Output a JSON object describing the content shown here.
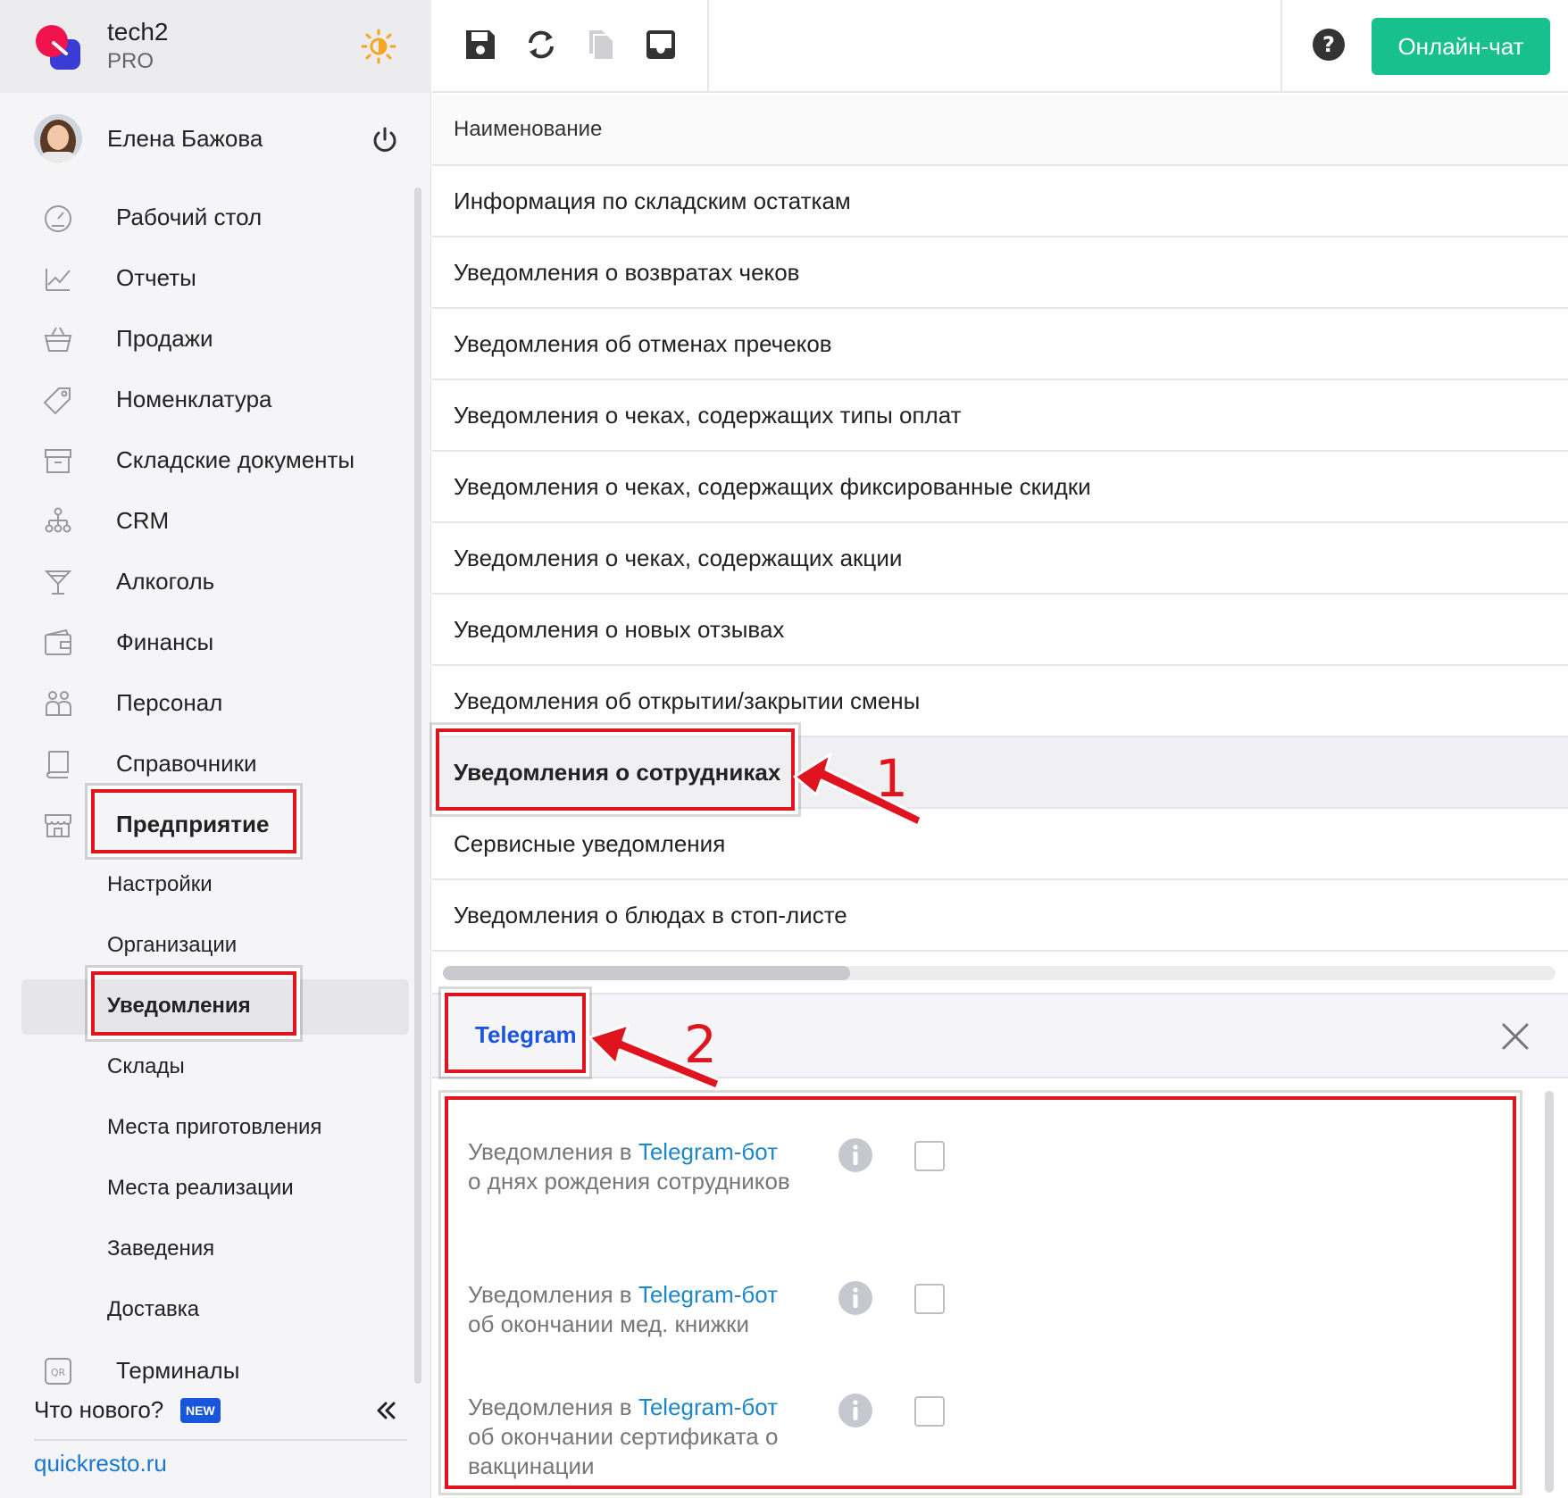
{
  "brand": {
    "name": "tech2",
    "plan": "PRO"
  },
  "user": {
    "name": "Елена Бажова"
  },
  "nav": {
    "items": [
      {
        "label": "Рабочий стол",
        "icon": "dashboard-icon"
      },
      {
        "label": "Отчеты",
        "icon": "chart-icon"
      },
      {
        "label": "Продажи",
        "icon": "basket-icon"
      },
      {
        "label": "Номенклатура",
        "icon": "tag-icon"
      },
      {
        "label": "Складские документы",
        "icon": "archive-icon"
      },
      {
        "label": "CRM",
        "icon": "org-chart-icon"
      },
      {
        "label": "Алкоголь",
        "icon": "cocktail-icon"
      },
      {
        "label": "Финансы",
        "icon": "wallet-icon"
      },
      {
        "label": "Персонал",
        "icon": "people-icon"
      },
      {
        "label": "Справочники",
        "icon": "book-icon"
      },
      {
        "label": "Предприятие",
        "icon": "store-icon"
      }
    ],
    "subitems": [
      "Настройки",
      "Организации",
      "Уведомления",
      "Склады",
      "Места приготовления",
      "Места реализации",
      "Заведения",
      "Доставка"
    ],
    "terminals": {
      "label": "Терминалы",
      "icon": "qr-icon"
    }
  },
  "footer": {
    "whats_new": "Что нового?",
    "badge": "NEW",
    "site": "quickresto.ru"
  },
  "toolbar": {
    "chat_label": "Онлайн-чат"
  },
  "table": {
    "header": "Наименование",
    "rows": [
      "Информация по складским остаткам",
      "Уведомления о возвратах чеков",
      "Уведомления об отменах пречеков",
      "Уведомления о чеках, содержащих типы оплат",
      "Уведомления о чеках, содержащих фиксированные скидки",
      "Уведомления о чеках, содержащих акции",
      "Уведомления о новых отзывах",
      "Уведомления об открытии/закрытии смены",
      "Уведомления о сотрудниках",
      "Сервисные уведомления",
      "Уведомления о блюдах в стоп-листе"
    ],
    "selected_index": 8
  },
  "panel": {
    "tab": "Telegram",
    "settings": [
      {
        "prefix": "Уведомления в ",
        "link": "Telegram-бот",
        "rest": "о днях рождения сотрудников",
        "checked": false
      },
      {
        "prefix": "Уведомления в ",
        "link": "Telegram-бот",
        "rest": "об окончании мед. книжки",
        "checked": false
      },
      {
        "prefix": "Уведомления в ",
        "link": "Telegram-бот",
        "rest": "об окончании сертификата о вакцинации",
        "checked": false
      }
    ]
  },
  "annotations": {
    "step1": "1",
    "step2": "2"
  },
  "colors": {
    "accent": "#17c08c",
    "link": "#1a56db",
    "highlight": "#e0141e"
  }
}
